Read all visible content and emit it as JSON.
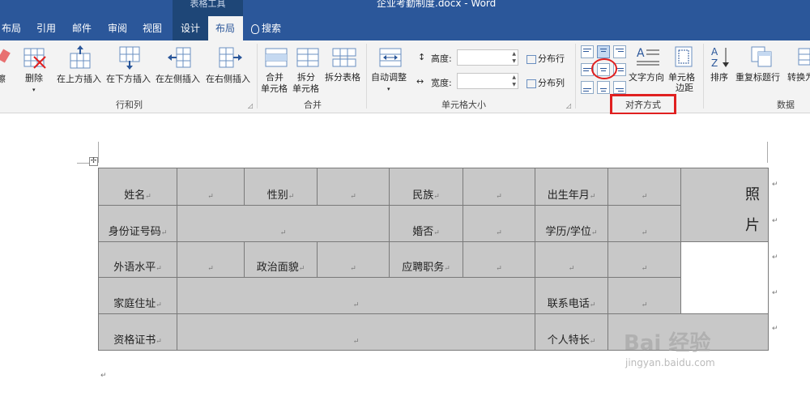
{
  "titlebar": {
    "context_tab": "表格工具",
    "doc_title": "企业考勤制度.docx - Word"
  },
  "tabs": [
    {
      "label": "布局"
    },
    {
      "label": "引用"
    },
    {
      "label": "邮件"
    },
    {
      "label": "审阅"
    },
    {
      "label": "视图"
    },
    {
      "label": "设计"
    },
    {
      "label": "布局"
    }
  ],
  "search": {
    "label": "搜索"
  },
  "ribbon": {
    "eraser_label": "擦",
    "delete_label": "删除",
    "insert_above": "在上方插入",
    "insert_below": "在下方插入",
    "insert_left": "在左侧插入",
    "insert_right": "在右侧插入",
    "rows_cols_group": "行和列",
    "merge_cells": "合并单元格",
    "merge_line1": "合并",
    "merge_line2": "单元格",
    "split_cells_line1": "拆分",
    "split_cells_line2": "单元格",
    "split_table": "拆分表格",
    "merge_group": "合并",
    "autofit": "自动调整",
    "height_label": "高度:",
    "width_label": "宽度:",
    "height_value": "",
    "width_value": "",
    "distribute_rows": "分布行",
    "distribute_cols": "分布列",
    "cell_size_group": "单元格大小",
    "text_direction": "文字方向",
    "cell_margins_line1": "单元格",
    "cell_margins_line2": "边距",
    "alignment_group": "对齐方式",
    "sort": "排序",
    "repeat_header": "重复标题行",
    "convert": "转换为",
    "data_group": "数据"
  },
  "table": {
    "r1": {
      "name": "姓名",
      "gender": "性别",
      "ethnicity": "民族",
      "birth": "出生年月",
      "photo_line1": "照",
      "photo_line2": "片"
    },
    "r2": {
      "id": "身份证号码",
      "married": "婚否",
      "edu": "学历/学位"
    },
    "r3": {
      "lang": "外语水平",
      "political": "政治面貌",
      "position": "应聘职务"
    },
    "r4": {
      "address": "家庭住址",
      "phone": "联系电话"
    },
    "r5": {
      "cert": "资格证书",
      "specialty": "个人特长"
    },
    "mark": "↵"
  },
  "watermark": {
    "brand": "Bai 经验",
    "url": "jingyan.baidu.com"
  },
  "colors": {
    "brand_blue": "#2b579a",
    "highlight_red": "#e02020",
    "cell_gray": "#c8c8c8"
  }
}
